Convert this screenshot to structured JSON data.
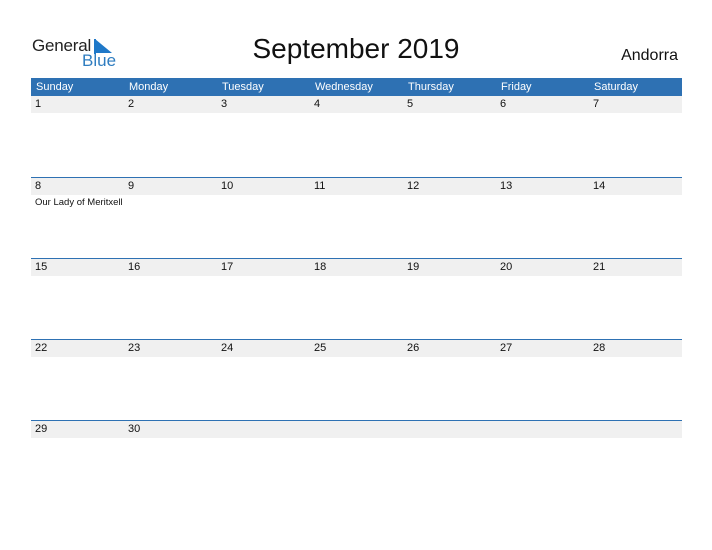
{
  "logo": {
    "line1": "General",
    "line2": "Blue"
  },
  "title": "September 2019",
  "country": "Andorra",
  "colors": {
    "header_bg": "#2e71b3",
    "date_row_bg": "#f0f0f0",
    "logo_blue": "#1f78c8"
  },
  "weekdays": [
    "Sunday",
    "Monday",
    "Tuesday",
    "Wednesday",
    "Thursday",
    "Friday",
    "Saturday"
  ],
  "weeks": [
    {
      "days": [
        "1",
        "2",
        "3",
        "4",
        "5",
        "6",
        "7"
      ],
      "events": [
        "",
        "",
        "",
        "",
        "",
        "",
        ""
      ]
    },
    {
      "days": [
        "8",
        "9",
        "10",
        "11",
        "12",
        "13",
        "14"
      ],
      "events": [
        "Our Lady of Meritxell",
        "",
        "",
        "",
        "",
        "",
        ""
      ]
    },
    {
      "days": [
        "15",
        "16",
        "17",
        "18",
        "19",
        "20",
        "21"
      ],
      "events": [
        "",
        "",
        "",
        "",
        "",
        "",
        ""
      ]
    },
    {
      "days": [
        "22",
        "23",
        "24",
        "25",
        "26",
        "27",
        "28"
      ],
      "events": [
        "",
        "",
        "",
        "",
        "",
        "",
        ""
      ]
    },
    {
      "days": [
        "29",
        "30",
        "",
        "",
        "",
        "",
        ""
      ],
      "events": [
        "",
        "",
        "",
        "",
        "",
        "",
        ""
      ]
    }
  ]
}
